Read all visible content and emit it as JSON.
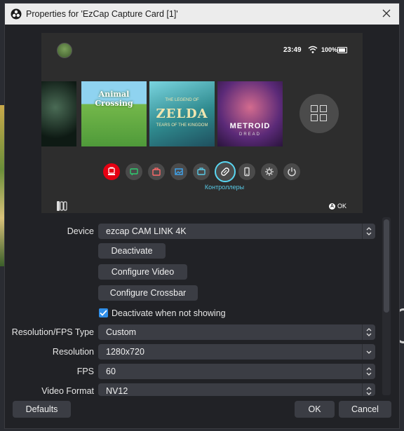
{
  "window": {
    "title": "Properties for 'EzCap Capture Card [1]'",
    "obs_icon": "obs-logo-icon",
    "close_icon": "close-icon"
  },
  "preview": {
    "status": {
      "time": "23:49",
      "battery_pct": "100%"
    },
    "games": [
      {
        "title": "",
        "subtitle": ""
      },
      {
        "title": "Animal Crossing",
        "subtitle": ""
      },
      {
        "title": "ZELDA",
        "subtitle": "THE LEGEND OF",
        "subtitle2": "TEARS OF THE KINGDOM"
      },
      {
        "title": "METROID",
        "subtitle": "DREAD",
        "subtitle2": ""
      }
    ],
    "eshop_badge": "eShop",
    "home_buttons": [
      "news-icon",
      "eshop-icon",
      "album-icon",
      "controllers-icon",
      "system-settings-icon",
      "sleep-icon"
    ],
    "selected_caption": "Контроллеры",
    "ok_hint": {
      "button": "A",
      "label": "OK"
    }
  },
  "form": {
    "device": {
      "label": "Device",
      "value": "ezcap CAM LINK 4K"
    },
    "deactivate_button": "Deactivate",
    "configure_video_button": "Configure Video",
    "configure_crossbar_button": "Configure Crossbar",
    "deactivate_when_not_showing": {
      "label": "Deactivate when not showing",
      "checked": true
    },
    "resolution_fps_type": {
      "label": "Resolution/FPS Type",
      "value": "Custom"
    },
    "resolution": {
      "label": "Resolution",
      "value": "1280x720"
    },
    "fps": {
      "label": "FPS",
      "value": "60"
    },
    "video_format": {
      "label": "Video Format",
      "value": "NV12"
    }
  },
  "footer": {
    "defaults": "Defaults",
    "ok": "OK",
    "cancel": "Cancel"
  },
  "colors": {
    "window_bg": "#212226",
    "control_bg": "#3b3d44",
    "accent": "#2f8ee8",
    "switch_highlight": "#59d6f1",
    "eshop_red": "#e60012"
  }
}
